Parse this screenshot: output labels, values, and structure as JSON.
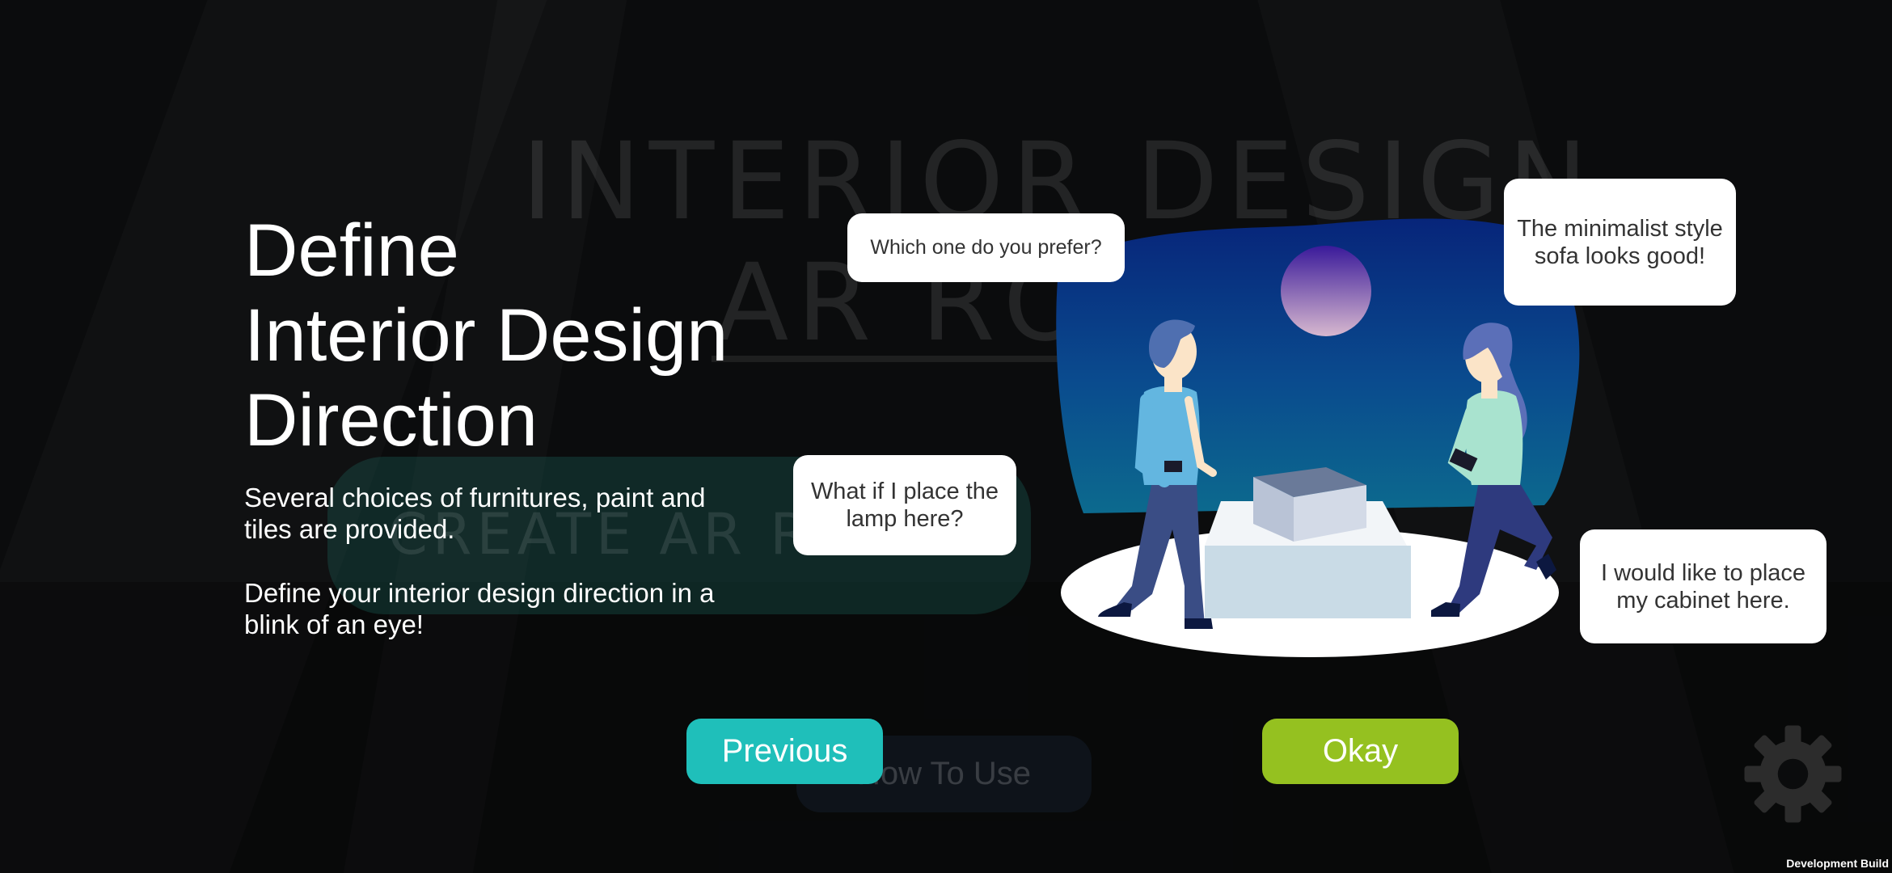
{
  "background": {
    "app_title_line1": "INTERIOR DESIGN",
    "app_title_line2": "AR ROOM",
    "create_button_label": "CREATE AR ROOM",
    "how_to_use_label": "How To Use",
    "settings_icon": "gear-icon",
    "dev_build_label": "Development Build"
  },
  "tutorial": {
    "heading_line1": "Define",
    "heading_line2": "Interior Design",
    "heading_line3": "Direction",
    "description_1": "Several choices of furnitures, paint and tiles are provided.",
    "description_2": "Define your interior design direction in a blink of an eye!",
    "previous_label": "Previous",
    "okay_label": "Okay"
  },
  "bubbles": {
    "prefer": "Which one do you prefer?",
    "minimalist": "The minimalist style sofa looks good!",
    "lamp": "What if I place the lamp here?",
    "cabinet": "I would like to place my cabinet here."
  },
  "colors": {
    "previous_button": "#1fbfba",
    "okay_button": "#95c120",
    "illustration_top": "#07257a",
    "illustration_bottom": "#0c6a8e"
  }
}
